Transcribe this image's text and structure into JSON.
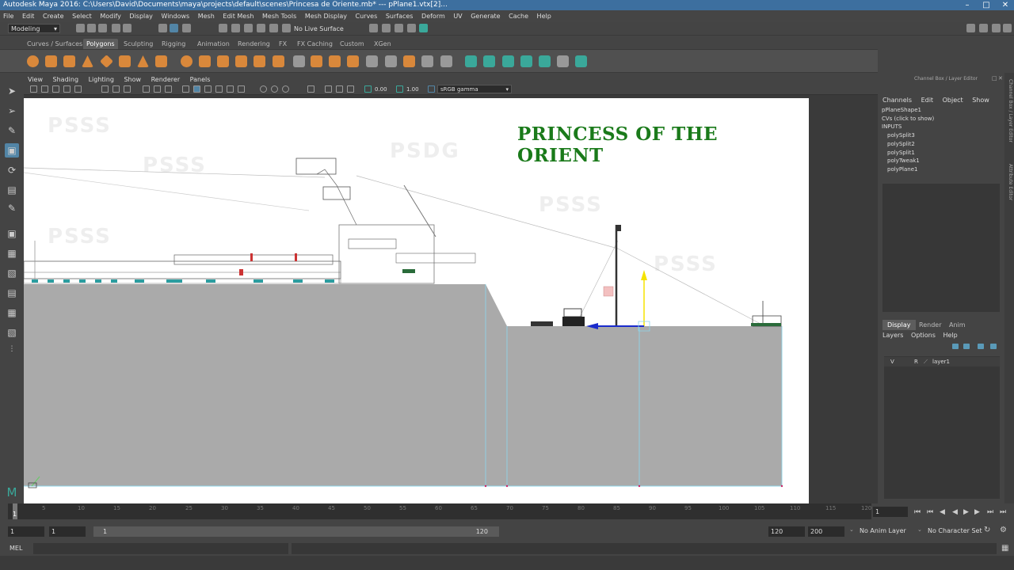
{
  "titlebar": {
    "title": "Autodesk Maya 2016: C:\\Users\\David\\Documents\\maya\\projects\\default\\scenes\\Princesa de Oriente.mb*   ---   pPlane1.vtx[2]..."
  },
  "menubar": {
    "items": [
      "File",
      "Edit",
      "Create",
      "Select",
      "Modify",
      "Display",
      "Windows",
      "Mesh",
      "Edit Mesh",
      "Mesh Tools",
      "Mesh Display",
      "Curves",
      "Surfaces",
      "Deform",
      "UV",
      "Generate",
      "Cache",
      "Help"
    ]
  },
  "statusline": {
    "menuset": "Modeling",
    "live_surface": "No Live Surface"
  },
  "shelf": {
    "tabs": [
      "Curves / Surfaces",
      "Polygons",
      "Sculpting",
      "Rigging",
      "Animation",
      "Rendering",
      "FX",
      "FX Caching",
      "Custom",
      "XGen"
    ],
    "active_tab": "Polygons"
  },
  "panel": {
    "menus": [
      "View",
      "Shading",
      "Lighting",
      "Show",
      "Renderer",
      "Panels"
    ],
    "exposure": "0.00",
    "gamma": "1.00",
    "color_space": "sRGB gamma"
  },
  "viewport": {
    "image_title": "PRINCESS OF THE ORIENT",
    "watermark": "PSSS",
    "watermark2": "PSDG"
  },
  "channelbox": {
    "header": "Channel Box / Layer Editor",
    "menus": [
      "Channels",
      "Edit",
      "Object",
      "Show"
    ],
    "node": "pPlaneShape1",
    "cvs": "CVs (click to show)",
    "inputs_label": "INPUTS",
    "inputs": [
      "polySplit3",
      "polySplit2",
      "polySplit1",
      "polyTweak1",
      "polyPlane1"
    ]
  },
  "sidetabs": {
    "tab1": "Channel Box / Layer Editor",
    "tab2": "Attribute Editor"
  },
  "layers": {
    "tabs": [
      "Display",
      "Render",
      "Anim"
    ],
    "active_tab": "Display",
    "menus": [
      "Layers",
      "Options",
      "Help"
    ],
    "row": {
      "v": "V",
      "r": "R",
      "name": "layer1"
    }
  },
  "timeslider": {
    "ticks": [
      "5",
      "10",
      "15",
      "20",
      "25",
      "30",
      "35",
      "40",
      "45",
      "50",
      "55",
      "60",
      "65",
      "70",
      "75",
      "80",
      "85",
      "90",
      "95",
      "100",
      "105",
      "110",
      "115",
      "120"
    ],
    "current_marker": "1",
    "current_frame": "1"
  },
  "range": {
    "start": "1",
    "inner_start": "1",
    "slider_start": "1",
    "slider_end": "120",
    "end": "120",
    "outer_end": "200",
    "anim_layer": "No Anim Layer",
    "char_set": "No Character Set"
  },
  "cmdline": {
    "label": "MEL"
  },
  "colors": {
    "accent": "#5285a6",
    "title_green": "#1a7a1a",
    "plane_gray": "#aaaaaa",
    "titlebar": "#3d6f9f"
  }
}
